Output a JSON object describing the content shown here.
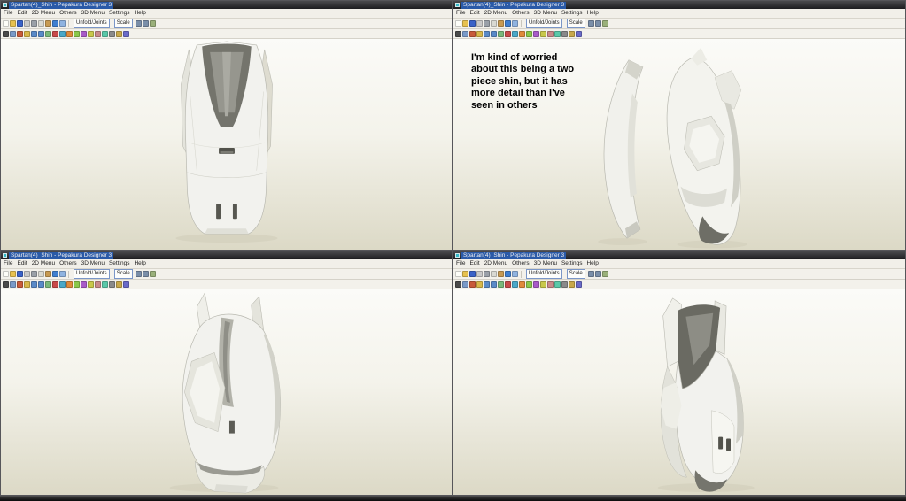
{
  "window": {
    "title": "Spartan(4)_Shin - Pepakura Designer 3",
    "menus": [
      {
        "name": "menu-file",
        "label": "File"
      },
      {
        "name": "menu-edit",
        "label": "Edit"
      },
      {
        "name": "menu-2d",
        "label": "2D Menu"
      },
      {
        "name": "menu-others",
        "label": "Others"
      },
      {
        "name": "menu-3d",
        "label": "3D Menu"
      },
      {
        "name": "menu-settings",
        "label": "Settings"
      },
      {
        "name": "menu-help",
        "label": "Help"
      }
    ],
    "toolbar_main": {
      "icons_left": [
        {
          "name": "new-file-icon",
          "glyph": "▢",
          "color": "#fdfdf8"
        },
        {
          "name": "open-icon",
          "glyph": "▤",
          "color": "#e7c14f"
        },
        {
          "name": "save-icon",
          "glyph": "▣",
          "color": "#3a62c8"
        },
        {
          "name": "print-icon",
          "glyph": "▥",
          "color": "#c9c9c9"
        },
        {
          "name": "cut-icon",
          "glyph": "✂",
          "color": "#9aa0a8"
        },
        {
          "name": "copy-icon",
          "glyph": "⧉",
          "color": "#d9d9d2"
        },
        {
          "name": "paste-icon",
          "glyph": "▦",
          "color": "#c79a52"
        },
        {
          "name": "undo-icon",
          "glyph": "↶",
          "color": "#3f7fd0"
        },
        {
          "name": "redo-icon",
          "glyph": "↷",
          "color": "#8fb3e0"
        }
      ],
      "unfold_button": "Unfold/Joints",
      "scale_button": "Scale",
      "icons_right": [
        {
          "name": "rotate-left-icon",
          "glyph": "⟲",
          "color": "#7a8ea8"
        },
        {
          "name": "rotate-right-icon",
          "glyph": "⟳",
          "color": "#7a8ea8"
        },
        {
          "name": "reset-view-icon",
          "glyph": "◎",
          "color": "#9ab07a"
        }
      ]
    },
    "toolbar_edit": {
      "icons": [
        {
          "name": "select-arrow-icon",
          "glyph": "➤",
          "color": "#4a4a4a"
        },
        {
          "name": "box-select-icon",
          "glyph": "▭",
          "color": "#7a9ac8"
        },
        {
          "name": "rotate-view-icon",
          "glyph": "↻",
          "color": "#c85a3a"
        },
        {
          "name": "pan-view-icon",
          "glyph": "✥",
          "color": "#d8b84a"
        },
        {
          "name": "zoom-in-icon",
          "glyph": "＋",
          "color": "#5a8ac8"
        },
        {
          "name": "zoom-out-icon",
          "glyph": "－",
          "color": "#5a8ac8"
        },
        {
          "name": "fit-view-icon",
          "glyph": "▣",
          "color": "#7ab87a"
        },
        {
          "name": "edge-select-icon",
          "glyph": "╱",
          "color": "#c84a4a"
        },
        {
          "name": "face-select-icon",
          "glyph": "▲",
          "color": "#4aa8c8"
        },
        {
          "name": "open-edge-icon",
          "glyph": "⌐",
          "color": "#e08a3a"
        },
        {
          "name": "join-edge-icon",
          "glyph": "⌶",
          "color": "#8ac84a"
        },
        {
          "name": "divide-edge-icon",
          "glyph": "÷",
          "color": "#a85ac8"
        },
        {
          "name": "add-flap-icon",
          "glyph": "◣",
          "color": "#c8c84a"
        },
        {
          "name": "remove-flap-icon",
          "glyph": "◢",
          "color": "#c88a8a"
        },
        {
          "name": "texture-view-icon",
          "glyph": "▩",
          "color": "#5ac8a8"
        },
        {
          "name": "grid-toggle-icon",
          "glyph": "▦",
          "color": "#8a8a8a"
        },
        {
          "name": "ruler-icon",
          "glyph": "⌗",
          "color": "#c8a84a"
        },
        {
          "name": "material-settings-icon",
          "glyph": "⚙",
          "color": "#6a6ac8"
        }
      ]
    }
  },
  "viewports": {
    "top_left": {
      "label": "shin front view"
    },
    "top_right": {
      "label": "shin exploded two-piece view",
      "annotation": "I'm kind of worried\nabout this being a two\npiece shin, but it has\nmore detail than I've\nseen in others"
    },
    "bottom_left": {
      "label": "shin three-quarter view"
    },
    "bottom_right": {
      "label": "shin back angled view"
    }
  },
  "taskbar": {
    "label": ""
  }
}
